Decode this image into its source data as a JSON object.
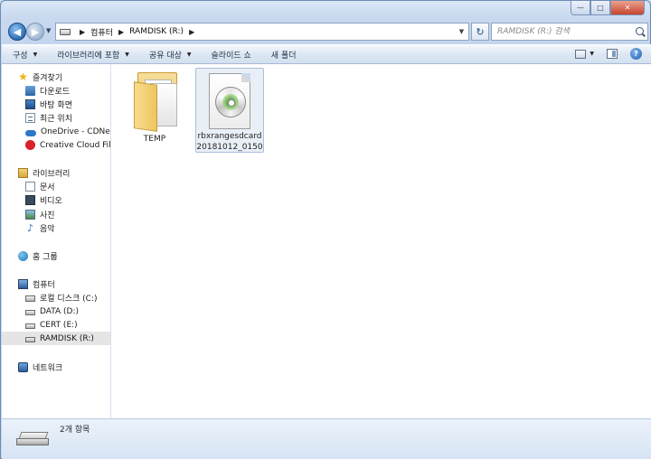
{
  "window": {
    "minimize_label": "—",
    "maximize_label": "□",
    "close_label": "✕"
  },
  "address_bar": {
    "crumbs": [
      "컴퓨터",
      "RAMDISK (R:)"
    ],
    "separator": "▶",
    "dropdown": "▼",
    "refresh_label": "↻"
  },
  "search": {
    "placeholder": "RAMDISK (R:) 검색"
  },
  "toolbar": {
    "items": [
      "구성",
      "라이브러리에 포함",
      "공유 대상",
      "슬라이드 쇼",
      "새 폴더"
    ],
    "help_label": "?"
  },
  "navigation": {
    "favorites_header": "즐겨찾기",
    "favorites": [
      "다운로드",
      "바탕 화면",
      "최근 위치",
      "OneDrive - CDNetwork",
      "Creative Cloud Files"
    ],
    "libraries_header": "라이브러리",
    "libraries": [
      "문서",
      "비디오",
      "사진",
      "음악"
    ],
    "homegroup": "홈 그룹",
    "computer_header": "컴퓨터",
    "drives": [
      "로컬 디스크 (C:)",
      "DATA (D:)",
      "CERT (E:)",
      "RAMDISK (R:)"
    ],
    "selected_drive": "RAMDISK (R:)",
    "network": "네트워크"
  },
  "files": [
    {
      "name": "TEMP",
      "type": "folder",
      "icon": "folder-icon"
    },
    {
      "name": "rbxrangesdcard20181012_0150",
      "type": "disc-image",
      "icon": "disc-image-icon"
    }
  ],
  "status": {
    "item_count": "2개 항목"
  }
}
